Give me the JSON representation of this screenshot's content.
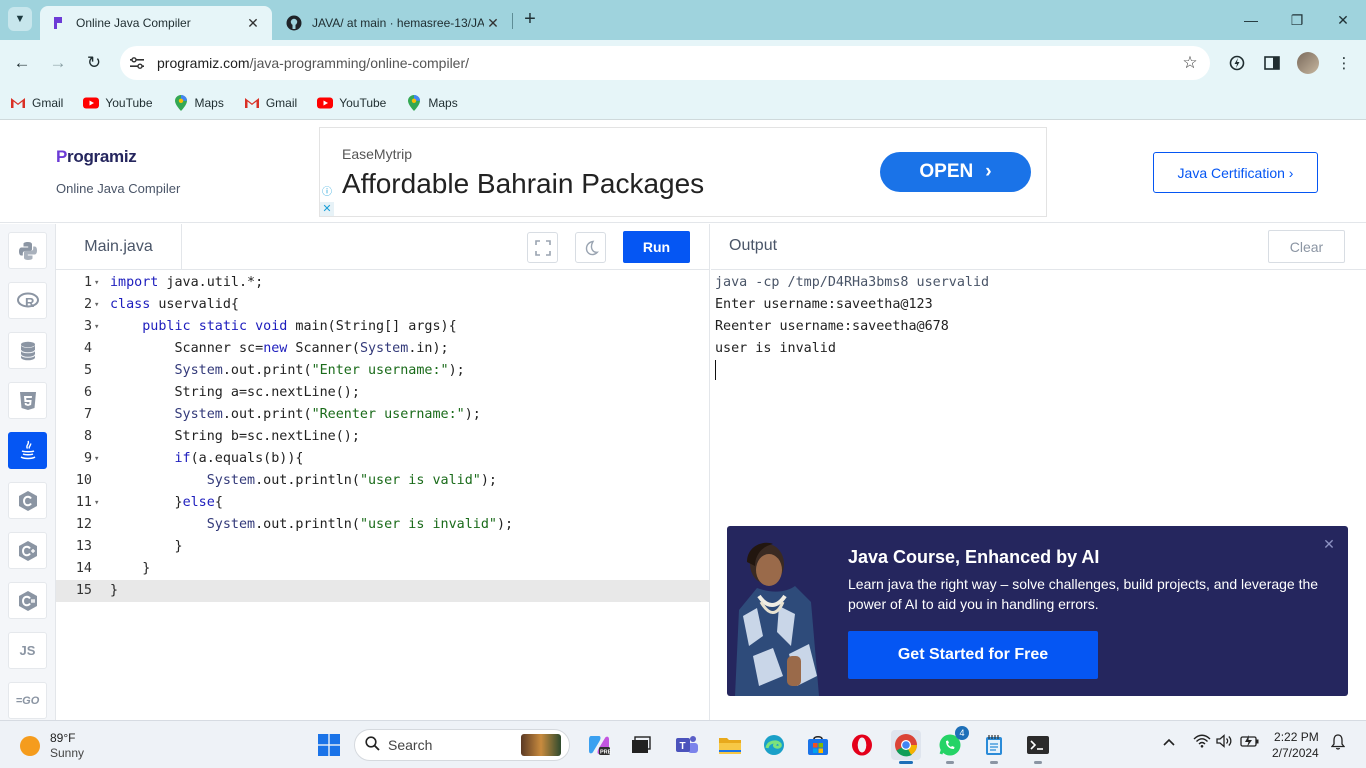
{
  "browser": {
    "tabs": [
      {
        "title": "Online Java Compiler",
        "active": true,
        "icon": "programiz-icon"
      },
      {
        "title": "JAVA/ at main · hemasree-13/JA",
        "active": false,
        "icon": "github-icon"
      }
    ],
    "url_host": "programiz.com",
    "url_path": "/java-programming/online-compiler/",
    "bookmarks": [
      {
        "label": "Gmail",
        "icon": "gmail-icon"
      },
      {
        "label": "YouTube",
        "icon": "youtube-icon"
      },
      {
        "label": "Maps",
        "icon": "maps-icon"
      },
      {
        "label": "Gmail",
        "icon": "gmail-icon"
      },
      {
        "label": "YouTube",
        "icon": "youtube-icon"
      },
      {
        "label": "Maps",
        "icon": "maps-icon"
      }
    ]
  },
  "header": {
    "logo_first": "P",
    "logo_rest": "rogramiz",
    "subtitle": "Online Java Compiler",
    "ad": {
      "brand": "EaseMytrip",
      "headline": "Affordable Bahrain Packages",
      "cta": "OPEN"
    },
    "cert_label": "Java Certification ›"
  },
  "sidebar": {
    "languages": [
      "python",
      "r",
      "sql",
      "html",
      "java",
      "c",
      "cpp",
      "csharp",
      "js",
      "go"
    ],
    "active": "java"
  },
  "editor": {
    "file_name": "Main.java",
    "run_label": "Run",
    "lines": [
      {
        "n": "1",
        "fold": true
      },
      {
        "n": "2",
        "fold": true
      },
      {
        "n": "3",
        "fold": true
      },
      {
        "n": "4",
        "fold": false
      },
      {
        "n": "5",
        "fold": false
      },
      {
        "n": "6",
        "fold": false
      },
      {
        "n": "7",
        "fold": false
      },
      {
        "n": "8",
        "fold": false
      },
      {
        "n": "9",
        "fold": true
      },
      {
        "n": "10",
        "fold": false
      },
      {
        "n": "11",
        "fold": true
      },
      {
        "n": "12",
        "fold": false
      },
      {
        "n": "13",
        "fold": false
      },
      {
        "n": "14",
        "fold": false
      },
      {
        "n": "15",
        "fold": false
      }
    ],
    "code": [
      "import java.util.*;",
      "class uservalid{",
      "    public static void main(String[] args){",
      "        Scanner sc=new Scanner(System.in);",
      "        System.out.print(\"Enter username:\");",
      "        String a=sc.nextLine();",
      "        System.out.print(\"Reenter username:\");",
      "        String b=sc.nextLine();",
      "        if(a.equals(b)){",
      "            System.out.println(\"user is valid\");",
      "        }else{",
      "            System.out.println(\"user is invalid\");",
      "        }",
      "    }",
      "}"
    ],
    "current_line": 15
  },
  "output": {
    "title": "Output",
    "clear_label": "Clear",
    "command": "java -cp /tmp/D4RHa3bms8 uservalid",
    "lines": [
      "Enter username:saveetha@123",
      "Reenter username:saveetha@678",
      "user is invalid"
    ]
  },
  "promo": {
    "title": "Java Course, Enhanced by AI",
    "description": "Learn java the right way – solve challenges, build projects, and leverage the power of AI to aid you in handling errors.",
    "cta": "Get Started for Free"
  },
  "taskbar": {
    "temperature": "89°F",
    "condition": "Sunny",
    "search_placeholder": "Search",
    "whatsapp_badge": "4",
    "time": "2:22 PM",
    "date": "2/7/2024"
  },
  "colors": {
    "accent": "#0556f3",
    "chrome_frame": "#9fd3dd",
    "chrome_toolbar": "#e6f5f8",
    "promo_bg": "#25265e"
  }
}
